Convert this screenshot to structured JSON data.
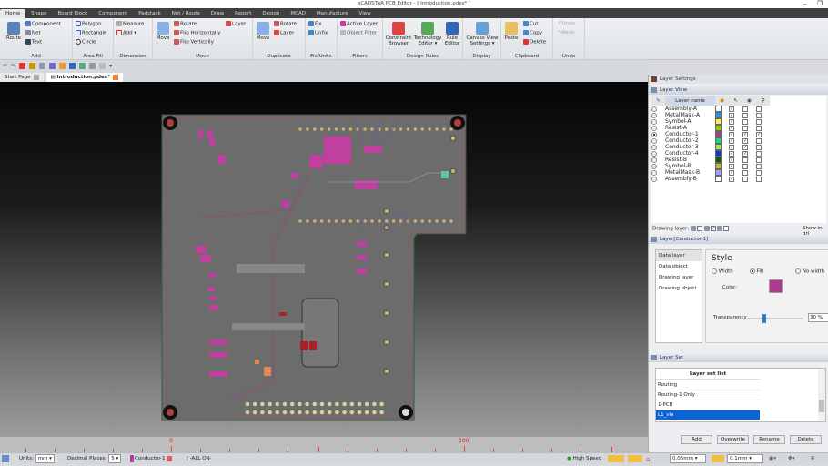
{
  "window": {
    "title": "eCADSTAR PCB Editor - [ Introduction.pdes* ]",
    "minimize": "–",
    "restore": "❐"
  },
  "menu_tabs": [
    "Home",
    "Shape",
    "Board Block",
    "Component",
    "Padstack",
    "Net / Route",
    "Draw",
    "Report",
    "Design",
    "MCAD",
    "Manufacture",
    "View"
  ],
  "ribbon": {
    "add": {
      "label": "Add",
      "route": "Route",
      "component": "Component",
      "net": "Net",
      "text": "Text"
    },
    "area_fill": {
      "label": "Area Fill",
      "polygon": "Polygon",
      "rectangle": "Rectangle",
      "circle": "Circle"
    },
    "dimension": {
      "label": "Dimension",
      "measure": "Measure",
      "add": "Add ▾"
    },
    "move": {
      "label": "Move",
      "move": "Move",
      "rotate": "Rotate",
      "flip_h": "Flip Horizontally",
      "flip_v": "Flip Vertically",
      "layer": "Layer"
    },
    "duplicate": {
      "label": "Duplicate",
      "move": "Move",
      "rotate": "Rotate",
      "layer": "Layer"
    },
    "fix_unfix": {
      "label": "Fix/Unfix",
      "fix": "Fix",
      "unfix": "Unfix"
    },
    "filters": {
      "label": "Filters",
      "active_layer": "Active Layer",
      "object_filter": "Object Filter"
    },
    "design_rules": {
      "label": "Design Rules",
      "constraint_browser": "Constraint Browser",
      "technology_editor": "Technology Editor ▾",
      "rule_editor": "Rule Editor"
    },
    "display": {
      "label": "Display",
      "canvas_view": "Canvas View Settings ▾"
    },
    "clipboard": {
      "label": "Clipboard",
      "paste": "Paste",
      "cut": "Cut",
      "copy": "Copy",
      "delete": "Delete"
    },
    "undo": {
      "label": "Undo",
      "undo": "Undo",
      "redo": "Redo"
    }
  },
  "doc_tabs": [
    "Start Page",
    "Introduction.pdes*"
  ],
  "ruler": {
    "labels": [
      "0",
      "100"
    ]
  },
  "panel": {
    "title": "Layer Settings",
    "layer_view": "Layer View",
    "layer_name_header": "Layer name",
    "layers": [
      {
        "name": "Assembly-A",
        "color": "#ffffff",
        "c1": true,
        "c2": false,
        "c3": false
      },
      {
        "name": "MetalMask-A",
        "color": "#2f8ee8",
        "c1": true,
        "c2": false,
        "c3": false
      },
      {
        "name": "Symbol-A",
        "color": "#ffef4a",
        "c1": true,
        "c2": false,
        "c3": false
      },
      {
        "name": "Resist-A",
        "color": "#8fd400",
        "c1": true,
        "c2": false,
        "c3": false
      },
      {
        "name": "Conductor-1",
        "color": "#b03a8e",
        "c1": true,
        "c2": true,
        "c3": true,
        "active": true
      },
      {
        "name": "Conductor-2",
        "color": "#17d985",
        "c1": true,
        "c2": true,
        "c3": false
      },
      {
        "name": "Conductor-3",
        "color": "#a8e84a",
        "c1": true,
        "c2": true,
        "c3": false
      },
      {
        "name": "Conductor-4",
        "color": "#1030f0",
        "c1": true,
        "c2": true,
        "c3": false
      },
      {
        "name": "Resist-B",
        "color": "#006400",
        "c1": true,
        "c2": false,
        "c3": false
      },
      {
        "name": "Symbol-B",
        "color": "#c8b42a",
        "c1": true,
        "c2": false,
        "c3": false
      },
      {
        "name": "MetalMask-B",
        "color": "#a0a0ff",
        "c1": true,
        "c2": false,
        "c3": false
      },
      {
        "name": "Assembly-B",
        "color": "#ffffff",
        "c1": true,
        "c2": false,
        "c3": false
      }
    ],
    "drawing_layer": "Drawing layer:",
    "show_in_grid": "Show in gri",
    "layer_detail_title": "Layer[Conductor-1]",
    "detail_nav": [
      "Data layer",
      "Data object",
      "Drawing layer",
      "Drawing object"
    ],
    "style": {
      "heading": "Style",
      "width": "Width",
      "fill": "Fill",
      "no_width": "No width",
      "selected": "Fill",
      "color_label": "Color:",
      "color": "#b03a8e",
      "transparency_label": "Transparency",
      "transparency": 30,
      "transparency_text": "30 %"
    },
    "layer_set": {
      "title": "Layer Set",
      "list_header": "Layer set list",
      "items": [
        "Routing",
        "Routing-1 Only",
        "1-PCB",
        "L1_via"
      ],
      "selected": "L1_via"
    },
    "buttons": [
      "Add",
      "Overwrite",
      "Rename",
      "Delete"
    ]
  },
  "status": {
    "units_label": "Units:",
    "units": "mm",
    "decimal_label": "Decimal Places:",
    "decimal": "5",
    "layer": "Conductor-1",
    "all_on": "-ALL ON-",
    "high_speed": "High Speed",
    "grid1": "0.05mm",
    "grid2": "0.1mm"
  }
}
